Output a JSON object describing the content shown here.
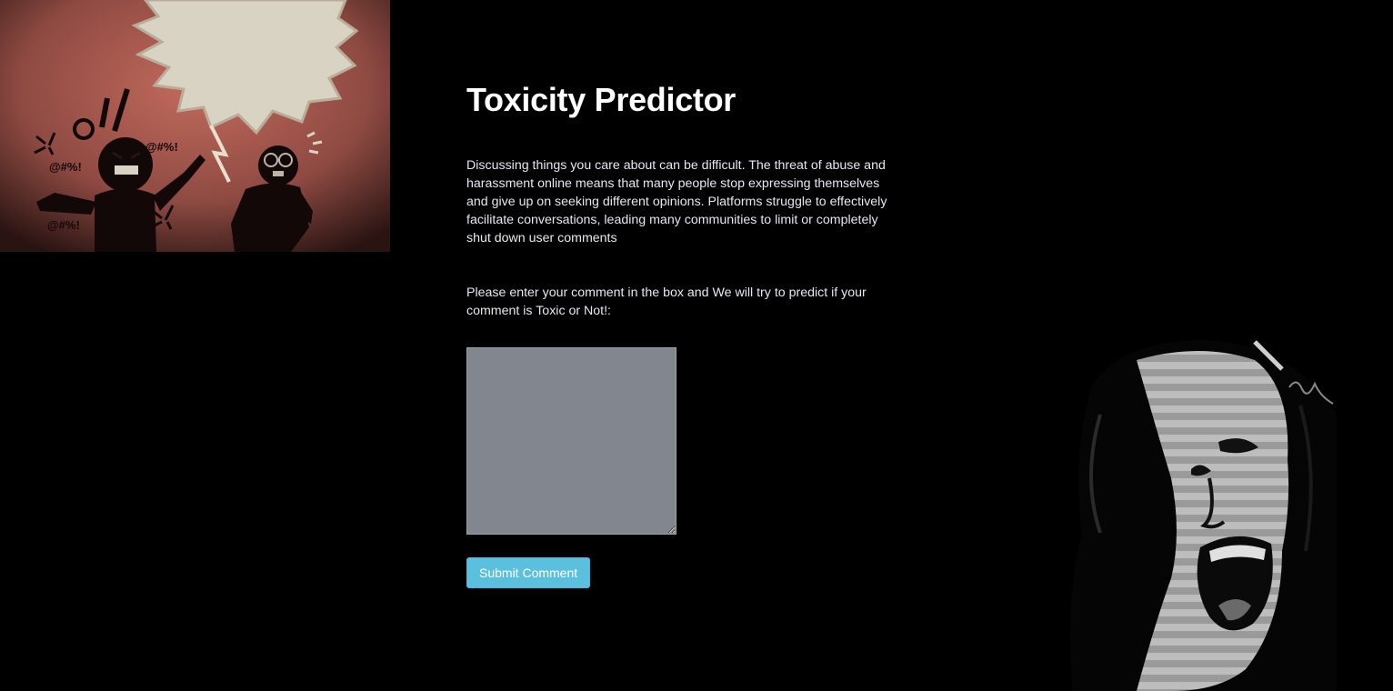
{
  "header": {
    "title": "Toxicity Predictor"
  },
  "main": {
    "description": "Discussing things you care about can be difficult. The threat of abuse and harassment online means that many people stop expressing themselves and give up on seeking different opinions. Platforms struggle to effectively facilitate conversations, leading many communities to limit or completely shut down user comments",
    "prompt": "Please enter your comment in the box and We will try to predict if your comment is Toxic or Not!:",
    "comment_value": "",
    "submit_label": "Submit Comment"
  },
  "illustrations": {
    "left_symbols": [
      "@#%!",
      "@#%!",
      "@#%!"
    ]
  },
  "colors": {
    "background": "#000000",
    "text": "#e6e7f2",
    "button": "#5bc0de",
    "textarea": "#82878f"
  }
}
